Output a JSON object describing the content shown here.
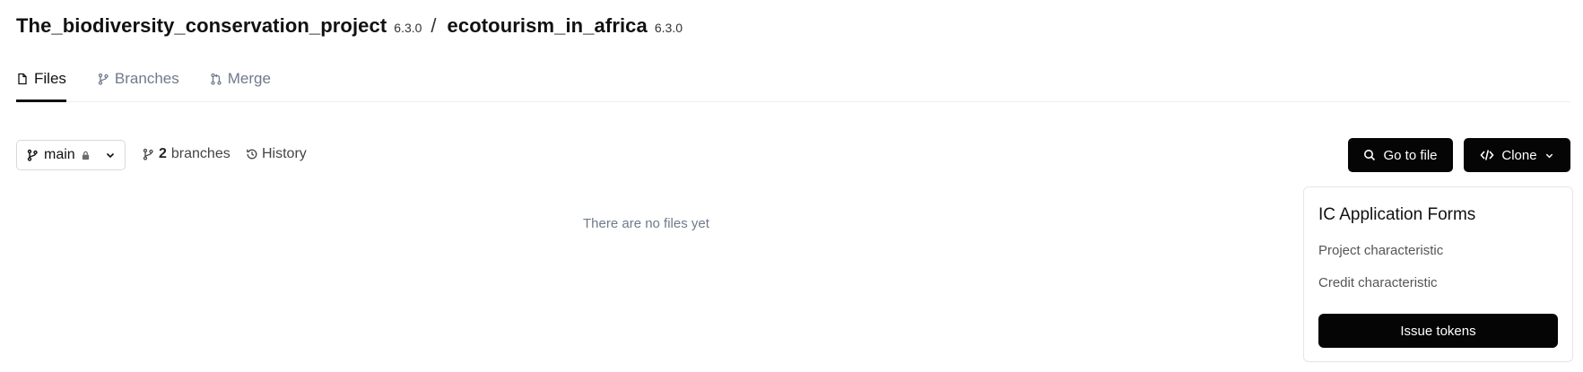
{
  "header": {
    "repo_name": "The_biodiversity_conservation_project",
    "repo_version": "6.3.0",
    "separator": "/",
    "sub_name": "ecotourism_in_africa",
    "sub_version": "6.3.0"
  },
  "tabs": [
    {
      "label": "Files",
      "icon": "file-icon",
      "active": true
    },
    {
      "label": "Branches",
      "icon": "branch-icon",
      "active": false
    },
    {
      "label": "Merge",
      "icon": "merge-icon",
      "active": false
    }
  ],
  "toolbar": {
    "branch_name": "main",
    "branch_count": "2",
    "branches_label": "branches",
    "history_label": "History",
    "goto_label": "Go to file",
    "clone_label": "Clone"
  },
  "empty_state": {
    "text": "There are no files yet"
  },
  "side_card": {
    "title": "IC Application Forms",
    "links": [
      "Project characteristic",
      "Credit characteristic"
    ],
    "button_label": "Issue tokens"
  },
  "colors": {
    "primary_button": "#050505",
    "muted_text": "#6f7a8c",
    "border": "#d6d9df"
  }
}
